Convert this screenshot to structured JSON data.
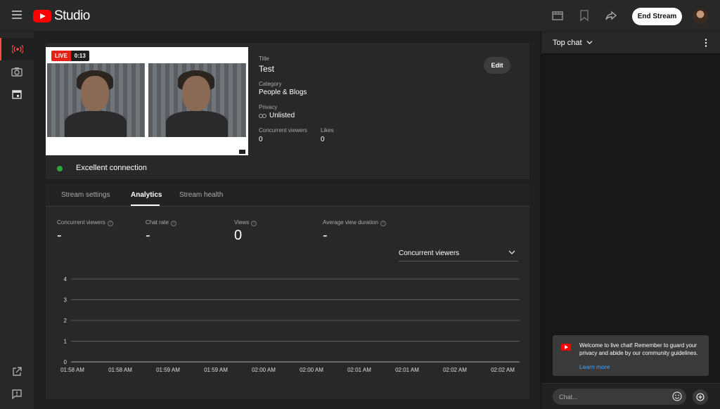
{
  "header": {
    "logo_text": "Studio",
    "end_stream_label": "End Stream",
    "icons": [
      "menu-icon",
      "clapperboard-icon",
      "bookmark-icon",
      "share-icon"
    ]
  },
  "rail": {
    "items": [
      "live-icon",
      "camera-icon",
      "calendar-icon"
    ],
    "bottom": [
      "external-link-icon",
      "feedback-icon"
    ]
  },
  "preview": {
    "live_label": "LIVE",
    "elapsed": "0:13",
    "connection": "Excellent connection",
    "connection_color": "#2ba640"
  },
  "stream_info": {
    "title_label": "Title",
    "title_value": "Test",
    "category_label": "Category",
    "category_value": "People & Blogs",
    "privacy_label": "Privacy",
    "privacy_value": "Unlisted",
    "concurrent_label": "Concurrent viewers",
    "concurrent_value": "0",
    "likes_label": "Likes",
    "likes_value": "0",
    "edit_label": "Edit"
  },
  "tabs": [
    {
      "label": "Stream settings"
    },
    {
      "label": "Analytics"
    },
    {
      "label": "Stream health"
    }
  ],
  "metrics": [
    {
      "label": "Concurrent viewers",
      "value": "-"
    },
    {
      "label": "Chat rate",
      "value": "-"
    },
    {
      "label": "Views",
      "value": "0"
    },
    {
      "label": "Average view duration",
      "value": "-"
    }
  ],
  "metric_selector": "Concurrent viewers",
  "chart_data": {
    "type": "line",
    "title": "",
    "xlabel": "",
    "ylabel": "",
    "y_ticks": [
      0,
      1,
      2,
      3,
      4
    ],
    "ylim": [
      0,
      4
    ],
    "x": [
      "01:58 AM",
      "01:58 AM",
      "01:59 AM",
      "01:59 AM",
      "02:00 AM",
      "02:00 AM",
      "02:01 AM",
      "02:01 AM",
      "02:02 AM",
      "02:02 AM"
    ],
    "series": [],
    "grid": true
  },
  "chat": {
    "title": "Top chat",
    "welcome": "Welcome to live chat! Remember to guard your privacy and abide by our community guidelines.",
    "learn_more": "Learn more",
    "input_placeholder": "Chat..."
  },
  "colors": {
    "accent_red": "#ff0000",
    "link_blue": "#3ea6ff",
    "live_red": "#e62117"
  }
}
